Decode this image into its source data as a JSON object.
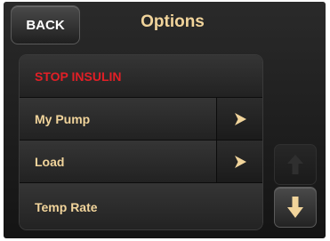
{
  "header": {
    "back_label": "BACK",
    "title": "Options"
  },
  "menu": {
    "items": [
      {
        "label": "STOP INSULIN",
        "has_arrow": false
      },
      {
        "label": "My Pump",
        "has_arrow": true
      },
      {
        "label": "Load",
        "has_arrow": true
      },
      {
        "label": "Temp Rate",
        "has_arrow": false
      }
    ]
  },
  "colors": {
    "accent": "#f1d49b",
    "stop": "#e21f26",
    "background": "#1a1a1a"
  },
  "icons": {
    "row_arrow": "chevron-right-icon",
    "scroll_up": "arrow-up-icon",
    "scroll_down": "arrow-down-icon"
  }
}
